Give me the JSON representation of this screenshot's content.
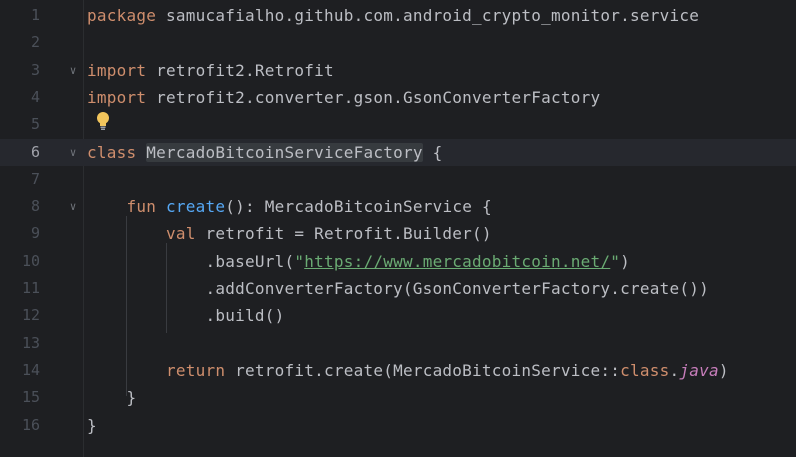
{
  "editor": {
    "lines": [
      {
        "num": "1",
        "segments": [
          {
            "t": "package",
            "c": "kw"
          },
          {
            "t": " samucafialho.github.com.android_crypto_monitor.service",
            "c": ""
          }
        ]
      },
      {
        "num": "2",
        "segments": []
      },
      {
        "num": "3",
        "segments": [
          {
            "t": "import",
            "c": "kw"
          },
          {
            "t": " retrofit2.Retrofit",
            "c": ""
          }
        ]
      },
      {
        "num": "4",
        "segments": [
          {
            "t": "import",
            "c": "kw"
          },
          {
            "t": " retrofit2.converter.gson.GsonConverterFactory",
            "c": ""
          }
        ]
      },
      {
        "num": "5",
        "segments": []
      },
      {
        "num": "6",
        "segments": [
          {
            "t": "class",
            "c": "kw"
          },
          {
            "t": " ",
            "c": ""
          },
          {
            "t": "MercadoBitcoinServiceFactory",
            "c": "highlight-box"
          },
          {
            "t": " {",
            "c": ""
          }
        ]
      },
      {
        "num": "7",
        "segments": []
      },
      {
        "num": "8",
        "segments": [
          {
            "t": "    ",
            "c": ""
          },
          {
            "t": "fun",
            "c": "kw"
          },
          {
            "t": " ",
            "c": ""
          },
          {
            "t": "create",
            "c": "fn"
          },
          {
            "t": "(): MercadoBitcoinService {",
            "c": ""
          }
        ]
      },
      {
        "num": "9",
        "segments": [
          {
            "t": "        ",
            "c": ""
          },
          {
            "t": "val",
            "c": "kw"
          },
          {
            "t": " retrofit = Retrofit.Builder()",
            "c": ""
          }
        ]
      },
      {
        "num": "10",
        "segments": [
          {
            "t": "            .baseUrl(",
            "c": ""
          },
          {
            "t": "\"",
            "c": "str"
          },
          {
            "t": "https://www.mercadobitcoin.net/",
            "c": "url"
          },
          {
            "t": "\"",
            "c": "str"
          },
          {
            "t": ")",
            "c": ""
          }
        ]
      },
      {
        "num": "11",
        "segments": [
          {
            "t": "            .addConverterFactory(GsonConverterFactory.create())",
            "c": ""
          }
        ]
      },
      {
        "num": "12",
        "segments": [
          {
            "t": "            .build()",
            "c": ""
          }
        ]
      },
      {
        "num": "13",
        "segments": []
      },
      {
        "num": "14",
        "segments": [
          {
            "t": "        ",
            "c": ""
          },
          {
            "t": "return",
            "c": "kw"
          },
          {
            "t": " retrofit.create(MercadoBitcoinService::",
            "c": ""
          },
          {
            "t": "class",
            "c": "kw"
          },
          {
            "t": ".",
            "c": ""
          },
          {
            "t": "java",
            "c": "italic-kw"
          },
          {
            "t": ")",
            "c": ""
          }
        ]
      },
      {
        "num": "15",
        "segments": [
          {
            "t": "    }",
            "c": ""
          }
        ]
      },
      {
        "num": "16",
        "segments": [
          {
            "t": "}",
            "c": ""
          }
        ]
      }
    ],
    "current_line": 6,
    "fold_lines": [
      3,
      6,
      8
    ],
    "fold_icon": "chevron-down-icon",
    "bulb_icon": "lightbulb-icon",
    "colors": {
      "background": "#1e1f22",
      "keyword": "#cf8e6d",
      "function": "#56a8f5",
      "string": "#6aab73",
      "plain": "#bcbec4",
      "line_number": "#4b5059"
    }
  }
}
